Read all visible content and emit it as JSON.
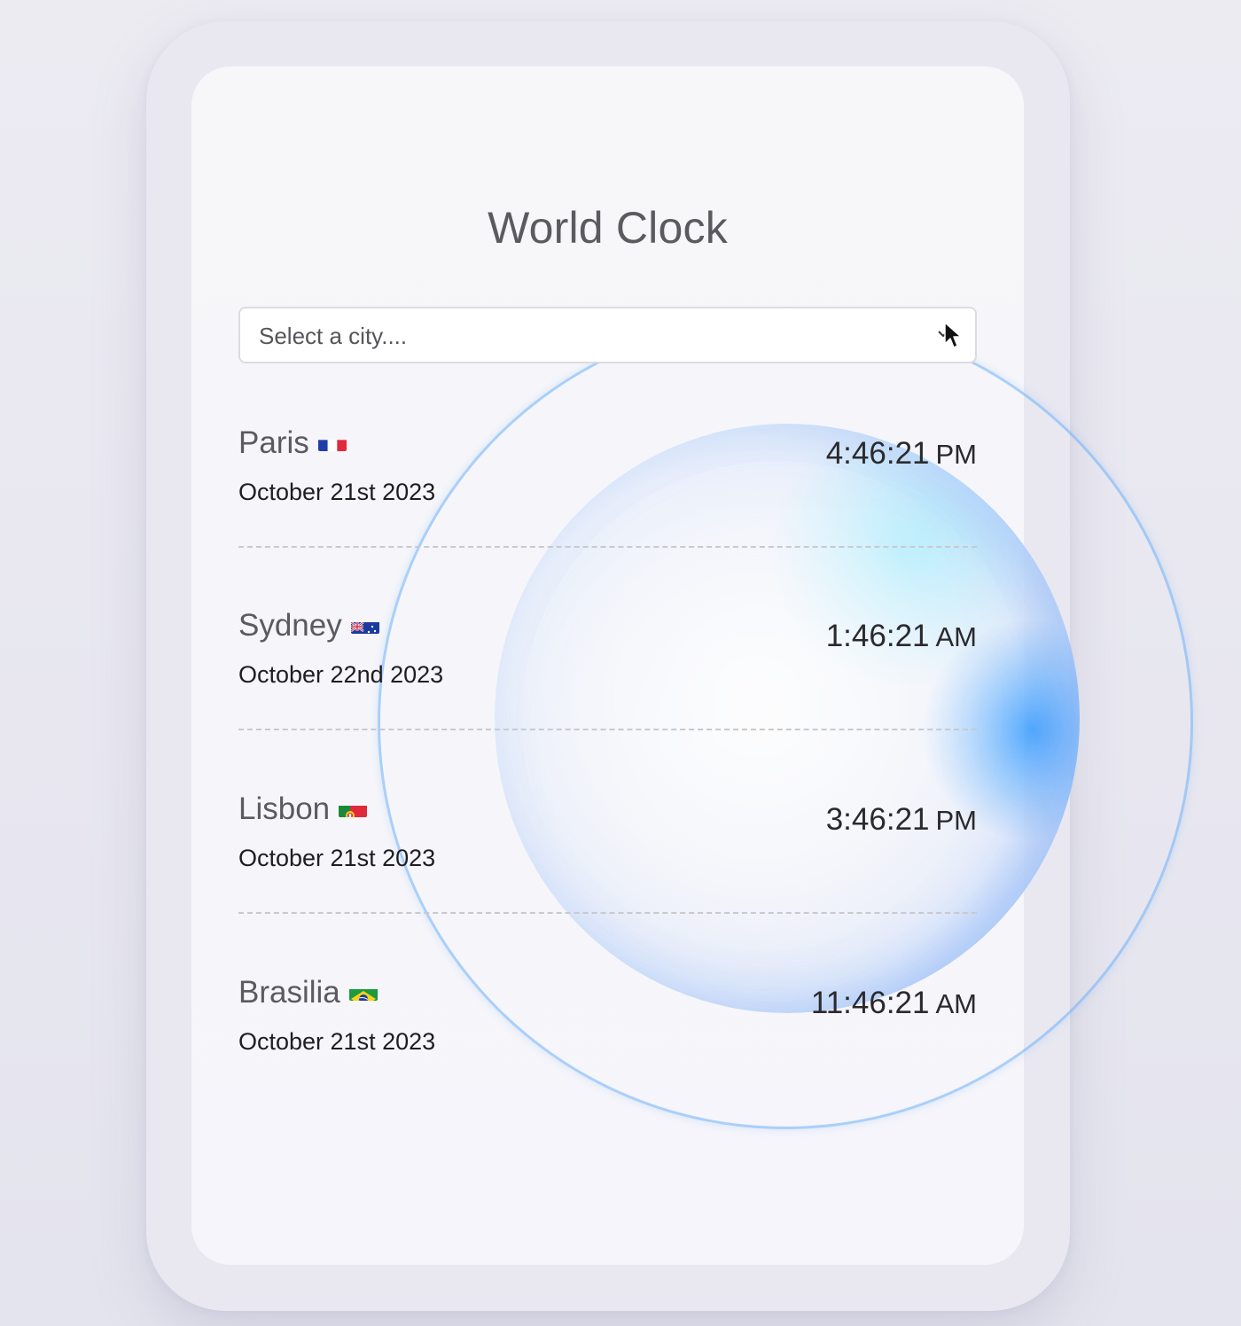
{
  "app": {
    "title": "World Clock"
  },
  "search": {
    "placeholder": "Select a city...."
  },
  "cities": [
    {
      "name": "Paris",
      "flag": "france-flag",
      "date": "October 21st 2023",
      "time": "4:46:21",
      "period": "PM"
    },
    {
      "name": "Sydney",
      "flag": "australia-flag",
      "date": "October 22nd 2023",
      "time": "1:46:21",
      "period": "AM"
    },
    {
      "name": "Lisbon",
      "flag": "portugal-flag",
      "date": "October 21st 2023",
      "time": "3:46:21",
      "period": "PM"
    },
    {
      "name": "Brasilia",
      "flag": "brazil-flag",
      "date": "October 21st 2023",
      "time": "11:46:21",
      "period": "AM"
    }
  ],
  "colors": {
    "background": "#e8e7f0",
    "card": "#f7f7f9",
    "title": "#5b5b5f",
    "orb_accent": "#2896ff"
  }
}
